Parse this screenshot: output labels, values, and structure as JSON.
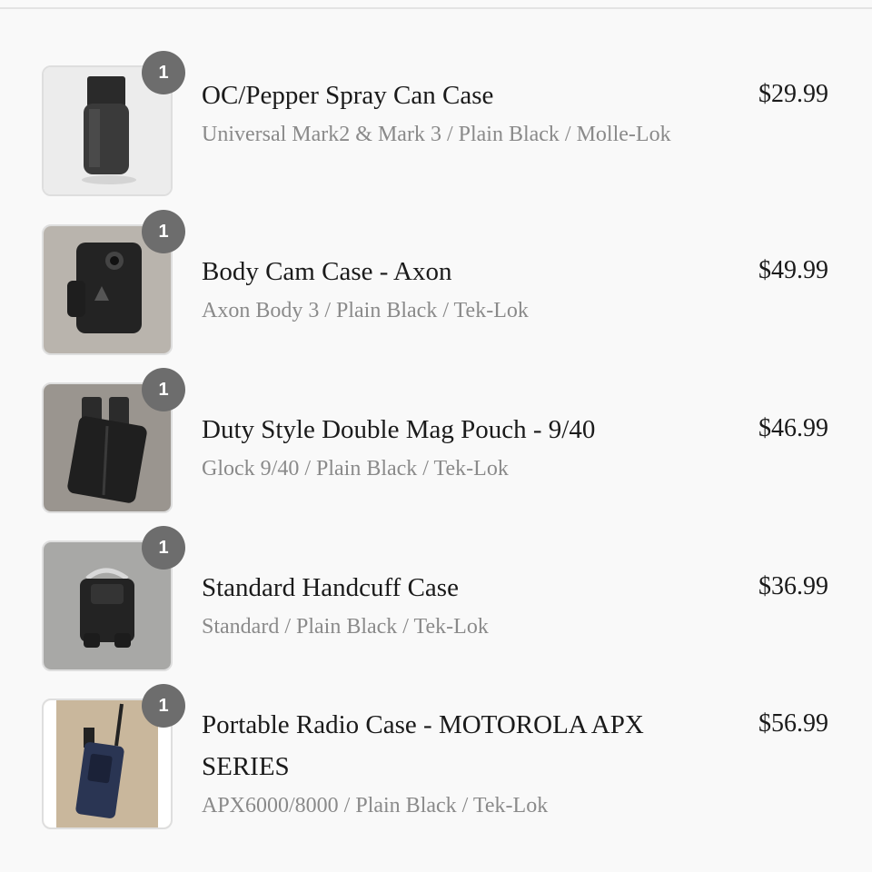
{
  "items": [
    {
      "quantity": "1",
      "title": "OC/Pepper Spray Can Case",
      "variant": "Universal Mark2 & Mark 3 / Plain Black / Molle-Lok",
      "price": "$29.99",
      "image_icon": "pepper-spray-case-icon"
    },
    {
      "quantity": "1",
      "title": "Body Cam Case - Axon",
      "variant": "Axon Body 3 / Plain Black / Tek-Lok",
      "price": "$49.99",
      "image_icon": "body-cam-case-icon"
    },
    {
      "quantity": "1",
      "title": "Duty Style Double Mag Pouch - 9/40",
      "variant": "Glock 9/40 / Plain Black / Tek-Lok",
      "price": "$46.99",
      "image_icon": "mag-pouch-icon"
    },
    {
      "quantity": "1",
      "title": "Standard Handcuff Case",
      "variant": "Standard / Plain Black / Tek-Lok",
      "price": "$36.99",
      "image_icon": "handcuff-case-icon"
    },
    {
      "quantity": "1",
      "title": "Portable Radio Case - MOTOROLA APX SERIES",
      "variant": "APX6000/8000 / Plain Black / Tek-Lok",
      "price": "$56.99",
      "image_icon": "radio-case-icon"
    }
  ],
  "colors": {
    "background": "#f9f9f9",
    "badge": "#6d6d6d",
    "title_text": "#1a1a1a",
    "variant_text": "#8a8a8a"
  }
}
